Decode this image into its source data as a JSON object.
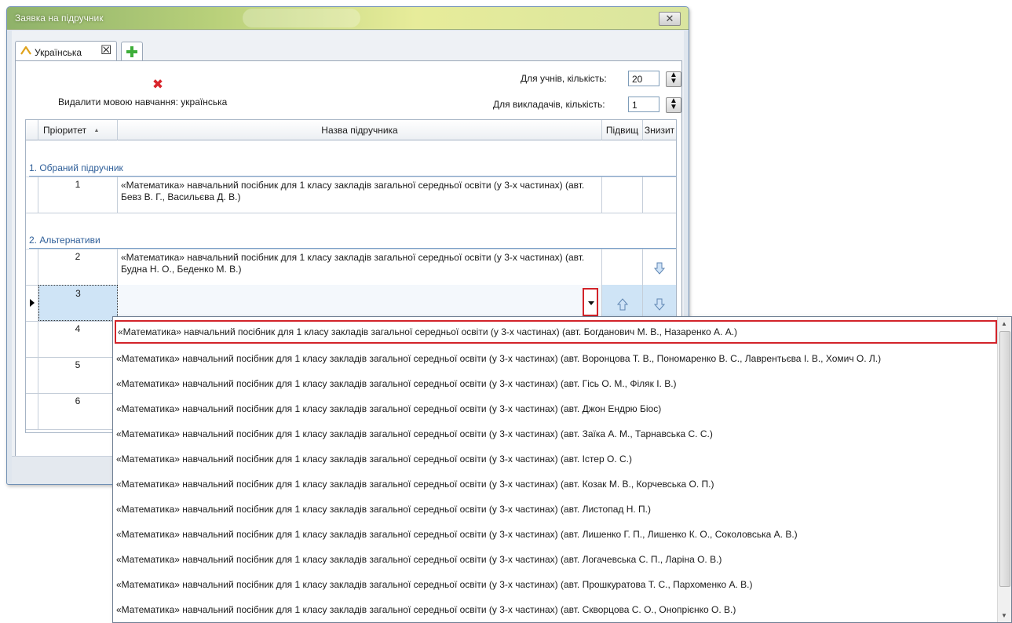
{
  "window": {
    "title": "Заявка на підручник",
    "close_symbol": "✕"
  },
  "tabs": {
    "active_label": "Українська",
    "close_symbol": "☒"
  },
  "delete_action": {
    "icon": "red-x-icon",
    "label": "Видалити мовою навчання: українська"
  },
  "quantities": {
    "students_label": "Для учнів, кількість:",
    "students_value": "20",
    "teachers_label": "Для викладачів, кількість:",
    "teachers_value": "1"
  },
  "grid": {
    "columns": {
      "priority": "Пріоритет",
      "priority_sort": "▲",
      "name": "Назва підручника",
      "up": "Підвищ",
      "down": "Знизит"
    },
    "groups": [
      {
        "label": "1. Обраний підручник"
      },
      {
        "label": "2. Альтернативи"
      }
    ],
    "rows": [
      {
        "priority": "1",
        "name": "«Математика» навчальний посібник для 1 класу закладів загальної середньої освіти (у 3-х частинах)  (авт. Бевз В. Г., Васильєва Д. В.)"
      },
      {
        "priority": "2",
        "name": "«Математика» навчальний посібник для 1 класу закладів загальної середньої освіти (у 3-х частинах)  (авт. Будна Н. О., Беденко М. В.)"
      },
      {
        "priority": "3",
        "name": ""
      },
      {
        "priority": "4",
        "name": ""
      },
      {
        "priority": "5",
        "name": ""
      },
      {
        "priority": "6",
        "name": ""
      }
    ]
  },
  "dropdown": {
    "items": [
      "«Математика» навчальний посібник для 1 класу закладів загальної середньої освіти (у 3-х частинах)  (авт. Богданович М. В., Назаренко А. А.)",
      "«Математика» навчальний посібник для 1 класу закладів загальної середньої освіти (у 3-х частинах)  (авт. Воронцова Т. В., Пономаренко В. С., Лаврентьєва І. В., Хомич О. Л.)",
      "«Математика» навчальний посібник для 1 класу закладів загальної середньої освіти (у 3-х частинах)  (авт. Гісь О. М., Філяк І. В.)",
      "«Математика» навчальний посібник для 1 класу закладів загальної середньої освіти (у 3-х частинах)  (авт. Джон Ендрю Біос)",
      "«Математика» навчальний посібник для 1 класу закладів загальної середньої освіти (у 3-х частинах)  (авт. Заїка А. М., Тарнавська С. С.)",
      "«Математика» навчальний посібник для 1 класу закладів загальної середньої освіти (у 3-х частинах)  (авт. Істер О. С.)",
      "«Математика» навчальний посібник для 1 класу закладів загальної середньої освіти (у 3-х частинах)  (авт. Козак М. В., Корчевська О. П.)",
      "«Математика» навчальний посібник для 1 класу закладів загальної середньої освіти (у 3-х частинах)  (авт. Листопад Н. П.)",
      "«Математика» навчальний посібник для 1 класу закладів загальної середньої освіти (у 3-х частинах)  (авт. Лишенко Г. П., Лишенко К. О., Соколовська А. В.)",
      "«Математика» навчальний посібник для 1 класу закладів загальної середньої освіти (у 3-х частинах)  (авт. Логачевська С. П., Ларіна О. В.)",
      "«Математика» навчальний посібник для 1 класу закладів загальної середньої освіти (у 3-х частинах)  (авт. Прошкуратова Т. С., Пархоменко А. В.)",
      "«Математика» навчальний посібник для 1 класу закладів загальної середньої освіти (у 3-х частинах)  (авт. Скворцова С. О., Онопрієнко О. В.)"
    ],
    "highlighted_index": 0
  },
  "colors": {
    "accent_red": "#d2232a",
    "selected_row": "#cfe4f6",
    "group_text": "#2f5f99"
  }
}
